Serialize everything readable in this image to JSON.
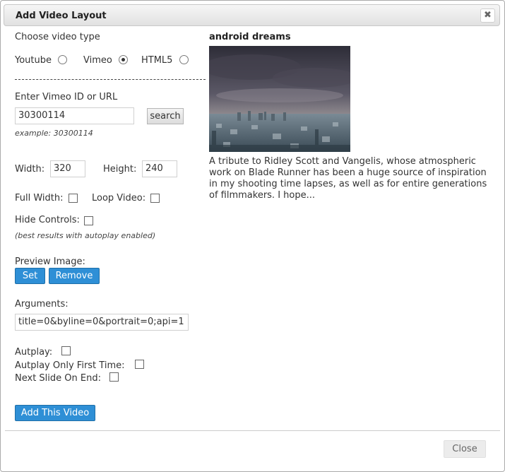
{
  "dialog": {
    "title": "Add Video Layout",
    "close_symbol": "✖"
  },
  "video_type": {
    "label": "Choose video type",
    "options": [
      {
        "label": "Youtube",
        "checked": false
      },
      {
        "label": "Vimeo",
        "checked": true
      },
      {
        "label": "HTML5",
        "checked": false
      }
    ]
  },
  "vimeo": {
    "label": "Enter Vimeo ID or URL",
    "value": "30300114",
    "search_label": "search",
    "example": "example: 30300114"
  },
  "size": {
    "width_label": "Width:",
    "width_value": "320",
    "height_label": "Height:",
    "height_value": "240"
  },
  "options": {
    "full_width_label": "Full Width:",
    "loop_label": "Loop Video:",
    "hide_controls_label": "Hide Controls:",
    "hide_controls_note": "(best results with autoplay enabled)"
  },
  "preview": {
    "label": "Preview Image:",
    "set_label": "Set",
    "remove_label": "Remove"
  },
  "arguments": {
    "label": "Arguments:",
    "value": "title=0&byline=0&portrait=0;api=1"
  },
  "autoplay": {
    "autoplay_label": "Autplay:",
    "first_time_label": "Autplay Only First Time:",
    "next_slide_label": "Next Slide On End:"
  },
  "add_button_label": "Add This Video",
  "video": {
    "title": "android dreams",
    "description": "A tribute to Ridley Scott and Vangelis, whose atmospheric work on Blade Runner has been a huge source of inspiration in my shooting time lapses, as well as for entire generations of filmmakers. I hope..."
  },
  "footer": {
    "close_label": "Close"
  }
}
